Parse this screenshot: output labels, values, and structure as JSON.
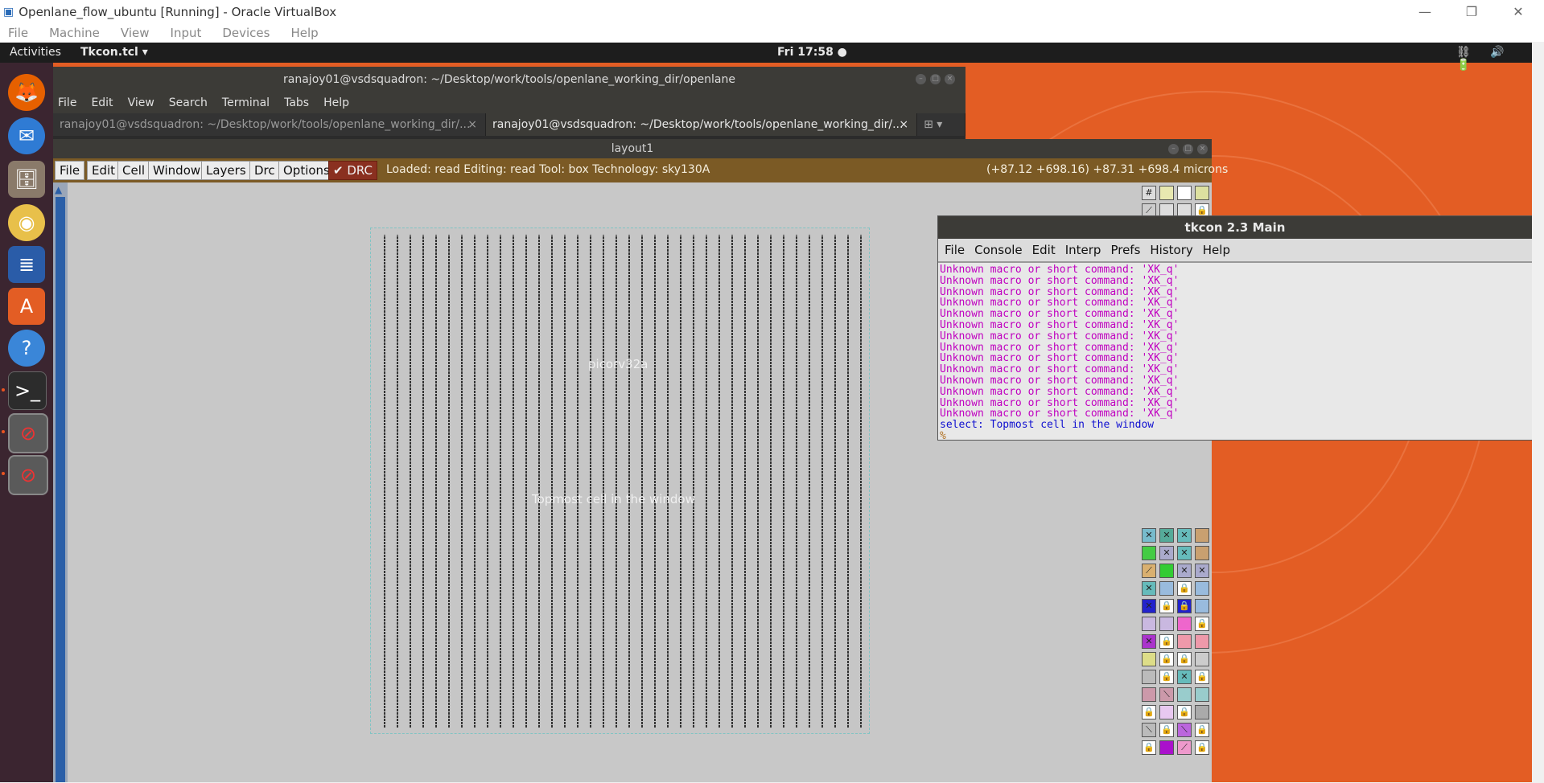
{
  "vbox": {
    "title": "Openlane_flow_ubuntu [Running] - Oracle VirtualBox",
    "menu": [
      "File",
      "Machine",
      "View",
      "Input",
      "Devices",
      "Help"
    ],
    "controls": {
      "minimize": "—",
      "restore": "❐",
      "close": "✕"
    }
  },
  "gnome": {
    "activities": "Activities",
    "app_menu": "Tkcon.tcl ▾",
    "clock": "Fri 17:58 ●",
    "tray": "⛓ 🔊 🔋"
  },
  "dock": {
    "items": [
      "firefox-icon",
      "thunderbird-icon",
      "files-icon",
      "rhythmbox-icon",
      "writer-icon",
      "software-icon",
      "help-icon",
      "terminal-icon",
      "magic-icon",
      "magic-icon"
    ]
  },
  "terminal": {
    "title": "ranajoy01@vsdsquadron: ~/Desktop/work/tools/openlane_working_dir/openlane",
    "menu": [
      "File",
      "Edit",
      "View",
      "Search",
      "Terminal",
      "Tabs",
      "Help"
    ],
    "tab1": "ranajoy01@vsdsquadron: ~/Desktop/work/tools/openlane_working_dir/...",
    "tab2": "ranajoy01@vsdsquadron: ~/Desktop/work/tools/openlane_working_dir/...",
    "tab_close": "×"
  },
  "layout": {
    "title": "layout1",
    "menu": [
      "File",
      "Edit",
      "Cell",
      "Window",
      "Layers",
      "Drc",
      "Options"
    ],
    "drc": "✔ DRC",
    "status": "Loaded: read  Editing: read  Tool: box   Technology: sky130A",
    "coords": "(+87.12 +698.16) +87.31 +698.4 microns",
    "cell_label": "picorv32a",
    "cell_caption": "Topmost cell in the window"
  },
  "tkcon": {
    "title": "tkcon 2.3 Main",
    "menu": [
      "File",
      "Console",
      "Edit",
      "Interp",
      "Prefs",
      "History",
      "Help"
    ],
    "lines": [
      "Unknown macro or short command: 'XK_q'",
      "Unknown macro or short command: 'XK_q'",
      "Unknown macro or short command: 'XK_q'",
      "Unknown macro or short command: 'XK_q'",
      "Unknown macro or short command: 'XK_q'",
      "Unknown macro or short command: 'XK_q'",
      "Unknown macro or short command: 'XK_q'",
      "Unknown macro or short command: 'XK_q'",
      "Unknown macro or short command: 'XK_q'",
      "Unknown macro or short command: 'XK_q'",
      "Unknown macro or short command: 'XK_q'",
      "Unknown macro or short command: 'XK_q'",
      "Unknown macro or short command: 'XK_q'",
      "Unknown macro or short command: 'XK_q'"
    ],
    "select_line": "select: Topmost cell in the window",
    "prompt": "%"
  },
  "colors": {
    "ubuntu_orange": "#e35d24",
    "magic_bar": "#7b5a25",
    "tkcon_magenta": "#c000c0",
    "tkcon_blue": "#1010d0"
  }
}
